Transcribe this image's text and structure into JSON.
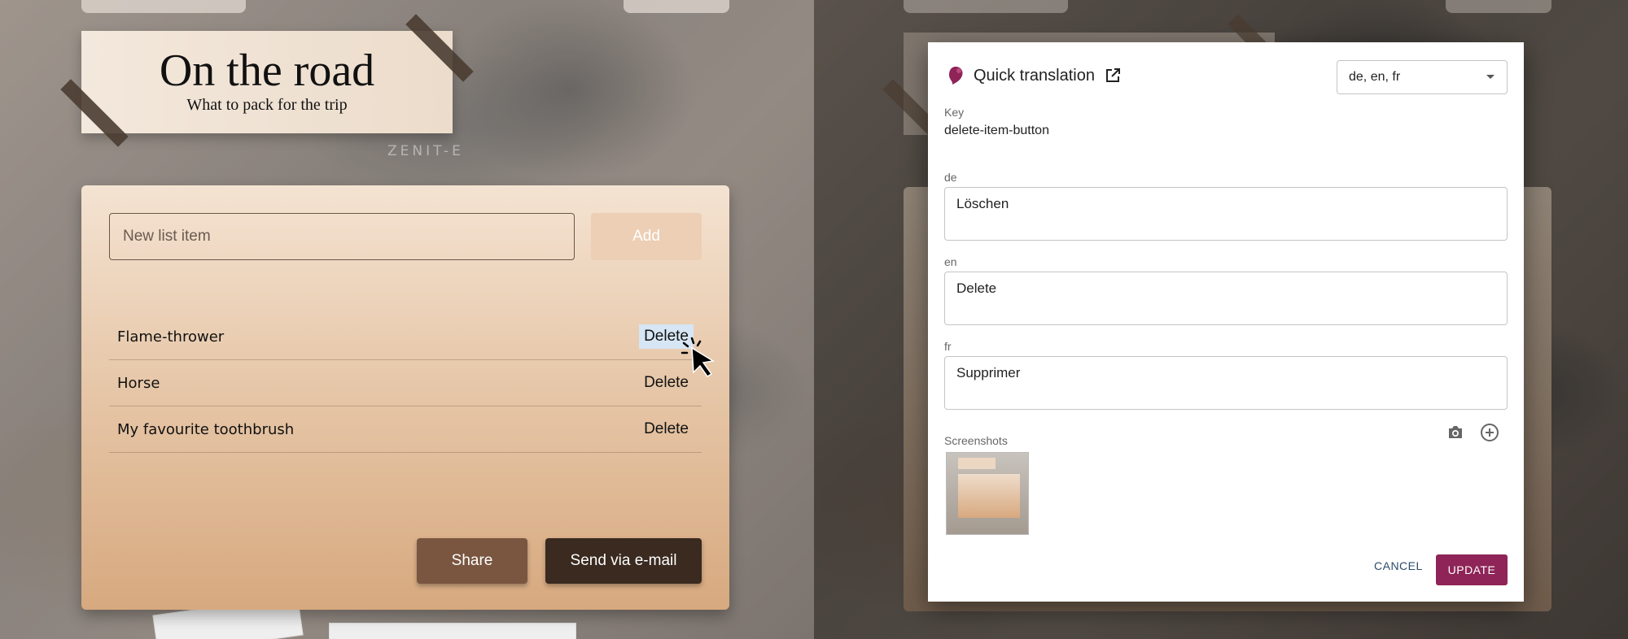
{
  "left": {
    "camera_brand": "ZENIT-E",
    "header": {
      "title": "On the road",
      "subtitle": "What to pack for the trip"
    },
    "new_item_placeholder": "New list item",
    "add_label": "Add",
    "items": [
      {
        "name": "Flame-thrower",
        "delete_label": "Delete",
        "selected": true
      },
      {
        "name": "Horse",
        "delete_label": "Delete",
        "selected": false
      },
      {
        "name": "My favourite toothbrush",
        "delete_label": "Delete",
        "selected": false
      }
    ],
    "share_label": "Share",
    "email_label": "Send via e-mail"
  },
  "dialog": {
    "title": "Quick translation",
    "languages_selected": "de, en, fr",
    "key_label": "Key",
    "key_value": "delete-item-button",
    "translations": [
      {
        "lang": "de",
        "value": "Löschen"
      },
      {
        "lang": "en",
        "value": "Delete"
      },
      {
        "lang": "fr",
        "value": "Supprimer"
      }
    ],
    "screenshots_label": "Screenshots",
    "cancel_label": "CANCEL",
    "update_label": "UPDATE",
    "icons": [
      "tolgee-logo-icon",
      "open-external-icon",
      "dropdown-arrow-icon",
      "camera-icon",
      "add-circle-icon",
      "pointer-cursor-icon"
    ],
    "accent_color": "#8e2457"
  }
}
